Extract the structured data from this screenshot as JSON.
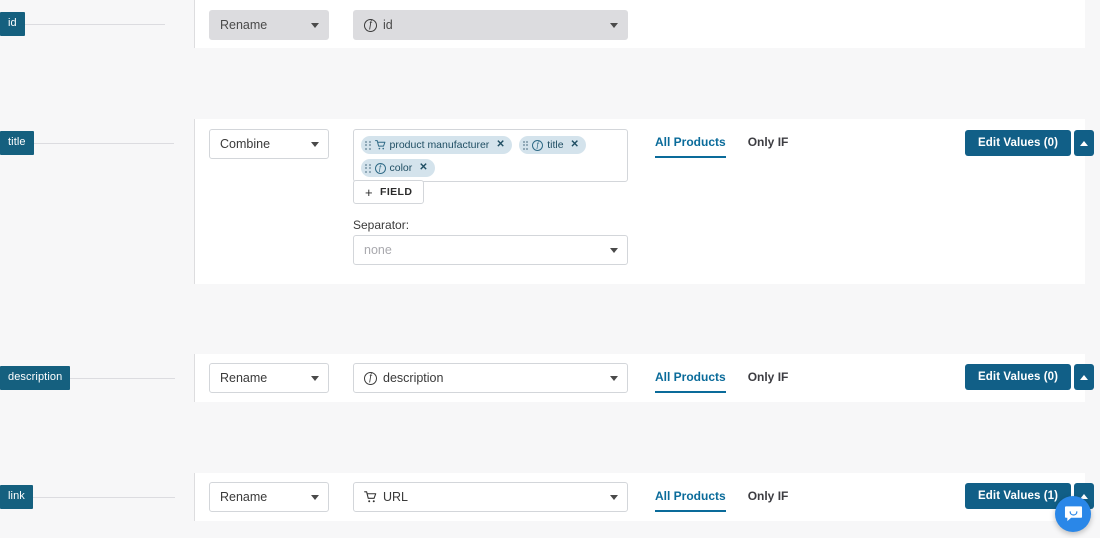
{
  "rows": [
    {
      "badge": "id",
      "transform": "Rename",
      "source": "id",
      "source_icon": "function-icon",
      "disabled": true,
      "has_tabs": false,
      "has_actions": false
    },
    {
      "badge": "title",
      "transform": "Combine",
      "disabled": false,
      "has_tabs": true,
      "has_actions": true,
      "tags": [
        {
          "label": "product manufacturer",
          "icon": "cart-icon",
          "remove": "✕"
        },
        {
          "label": "title",
          "icon": "function-icon",
          "remove": "✕"
        },
        {
          "label": "color",
          "icon": "function-icon",
          "remove": "✕"
        }
      ],
      "add_field_label": "FIELD",
      "add_field_plus": "+",
      "separator_label": "Separator:",
      "separator_value": "none",
      "tabs": [
        {
          "label": "All Products",
          "active": true
        },
        {
          "label": "Only IF",
          "active": false
        }
      ],
      "edit_values_label": "Edit Values (0)",
      "expand_caret": "▲"
    },
    {
      "badge": "description",
      "transform": "Rename",
      "source": "description",
      "source_icon": "function-icon",
      "disabled": false,
      "has_tabs": true,
      "has_actions": true,
      "tabs": [
        {
          "label": "All Products",
          "active": true
        },
        {
          "label": "Only IF",
          "active": false
        }
      ],
      "edit_values_label": "Edit Values (0)",
      "expand_caret": "▲"
    },
    {
      "badge": "link",
      "transform": "Rename",
      "source": "URL",
      "source_icon": "cart-icon",
      "disabled": false,
      "has_tabs": true,
      "has_actions": true,
      "tabs": [
        {
          "label": "All Products",
          "active": true
        },
        {
          "label": "Only IF",
          "active": false
        }
      ],
      "edit_values_label": "Edit Values (1)",
      "expand_caret": "▲"
    }
  ],
  "chat": {
    "icon": "chat-bubble-icon"
  },
  "colors": {
    "badge": "#15607f",
    "primary_button": "#115f87",
    "active_tab": "#0a6b9a",
    "tag": "#d4e3ec",
    "page_bg": "#f7f7f8",
    "chat": "#2a87e8"
  }
}
